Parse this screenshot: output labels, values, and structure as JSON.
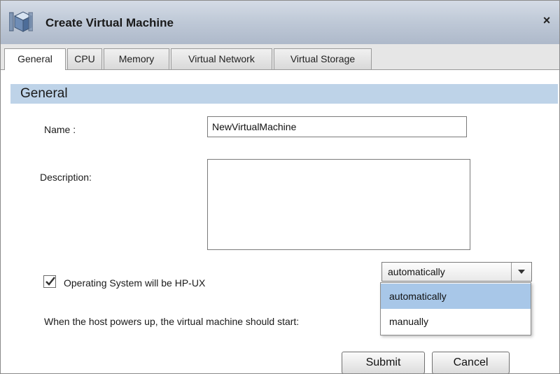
{
  "window": {
    "title": "Create Virtual Machine",
    "close_glyph": "×",
    "icon": "virtual-machine-cube-icon"
  },
  "tabs": [
    {
      "label": "General",
      "active": true
    },
    {
      "label": "CPU",
      "active": false
    },
    {
      "label": "Memory",
      "active": false
    },
    {
      "label": "Virtual Network",
      "active": false
    },
    {
      "label": "Virtual Storage",
      "active": false
    }
  ],
  "section": {
    "title": "General"
  },
  "form": {
    "name_label": "Name :",
    "name_value": "NewVirtualMachine",
    "description_label": "Description:",
    "description_value": "",
    "hpux_label": "Operating System will be HP-UX",
    "hpux_checked": true,
    "start_label": "When the host powers up, the virtual machine should start:",
    "start_selected": "automatically",
    "start_options": [
      {
        "label": "automatically",
        "highlighted": true
      },
      {
        "label": "manually",
        "highlighted": false
      }
    ]
  },
  "buttons": {
    "submit": "Submit",
    "cancel": "Cancel"
  },
  "colors": {
    "section_header_bg": "#bed3e8",
    "dropdown_highlight": "#a8c7e8",
    "titlebar": "#c0cad8"
  }
}
